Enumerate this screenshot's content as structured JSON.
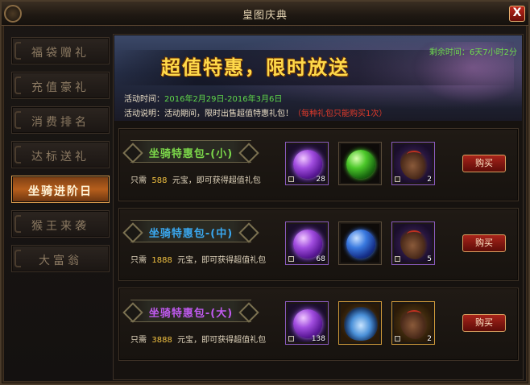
{
  "window": {
    "title": "皇图庆典",
    "close_label": "X"
  },
  "sidebar": {
    "items": [
      {
        "label": "福袋赠礼",
        "active": false
      },
      {
        "label": "充值豪礼",
        "active": false
      },
      {
        "label": "消费排名",
        "active": false
      },
      {
        "label": "达标送礼",
        "active": false
      },
      {
        "label": "坐骑进阶日",
        "active": true
      },
      {
        "label": "猴王来袭",
        "active": false
      },
      {
        "label": "大富翁",
        "active": false
      }
    ]
  },
  "banner": {
    "headline": "超值特惠，限时放送",
    "countdown": "剩余时间：6天7小时2分",
    "time_label": "活动时间：",
    "time_value": "2016年2月29日-2016年3月6日",
    "desc_label": "活动说明：",
    "desc_text": "活动期间，限时出售超值特惠礼包！",
    "desc_note": "（每种礼包只能购买1次）"
  },
  "packages": [
    {
      "name": "坐骑特惠包-(小)",
      "name_color": "#7cd84a",
      "desc_prefix": "只需",
      "price": "588",
      "desc_suffix": "元宝，即可获得超值礼包",
      "items": [
        {
          "icon": "purple-orb-icon",
          "count": "28"
        },
        {
          "icon": "green-orb-icon",
          "count": ""
        },
        {
          "icon": "mount-scroll-icon",
          "count": "2"
        }
      ],
      "buy_label": "购买"
    },
    {
      "name": "坐骑特惠包-(中)",
      "name_color": "#3aa8f0",
      "desc_prefix": "只需",
      "price": "1888",
      "desc_suffix": "元宝，即可获得超值礼包",
      "items": [
        {
          "icon": "purple-orb-icon",
          "count": "68"
        },
        {
          "icon": "blue-orb-icon",
          "count": ""
        },
        {
          "icon": "mount-scroll-icon",
          "count": "5"
        }
      ],
      "buy_label": "购买"
    },
    {
      "name": "坐骑特惠包-(大)",
      "name_color": "#c05af0",
      "desc_prefix": "只需",
      "price": "3888",
      "desc_suffix": "元宝，即可获得超值礼包",
      "items": [
        {
          "icon": "purple-orb-icon",
          "count": "138"
        },
        {
          "icon": "beast-mount-icon",
          "count": ""
        },
        {
          "icon": "mount-scroll-icon",
          "count": "2"
        }
      ],
      "buy_label": "购买"
    }
  ]
}
